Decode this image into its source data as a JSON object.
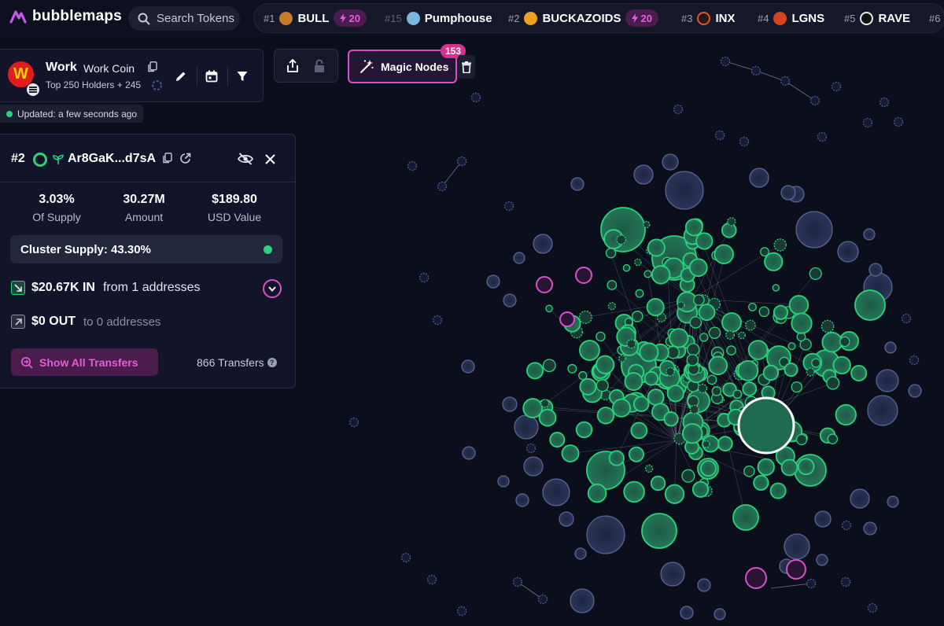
{
  "app": {
    "brand": "bubblemaps"
  },
  "search": {
    "placeholder": "Search Tokens"
  },
  "trending": [
    {
      "rank": "#1",
      "name": "BULL",
      "boost": "20",
      "logo_color": "#c87a2a"
    },
    {
      "rank": "#15",
      "name": "Pumphouse",
      "boost": "",
      "logo_color": "#7ab7e0"
    },
    {
      "rank": "#2",
      "name": "BUCKAZOIDS",
      "boost": "20",
      "logo_color": "#f0a020"
    },
    {
      "rank": "#3",
      "name": "INX",
      "boost": "",
      "logo_color": "#e0552a"
    },
    {
      "rank": "#4",
      "name": "LGNS",
      "boost": "",
      "logo_color": "#d8431f"
    },
    {
      "rank": "#5",
      "name": "RAVE",
      "boost": "",
      "logo_color": "#e8e8e8"
    },
    {
      "rank": "#6",
      "name": "",
      "boost": "",
      "logo_color": ""
    }
  ],
  "token": {
    "symbol": "Work",
    "name": "Work Coin",
    "logo_letter": "W",
    "holders": "Top 250 Holders + 245",
    "updated": "Updated: a few seconds ago"
  },
  "magic_nodes": {
    "label": "Magic Nodes",
    "count": "153"
  },
  "wallet": {
    "rank": "#2",
    "address": "Ar8GaK...d7sA",
    "stats": [
      {
        "value": "3.03%",
        "label": "Of Supply"
      },
      {
        "value": "30.27M",
        "label": "Amount"
      },
      {
        "value": "$189.80",
        "label": "USD Value"
      }
    ],
    "cluster_supply": "Cluster Supply: 43.30%",
    "in_amount": "$20.67K IN",
    "in_desc": "from 1 addresses",
    "out_amount": "$0 OUT",
    "out_desc": "to 0 addresses",
    "show_all": "Show All Transfers",
    "transfers": "866 Transfers"
  },
  "colors": {
    "background": "#0b0e1b",
    "cluster_green": "#2bd27c",
    "magic_pink": "#d94fc8",
    "neutral_bubble": "#2a3356"
  }
}
